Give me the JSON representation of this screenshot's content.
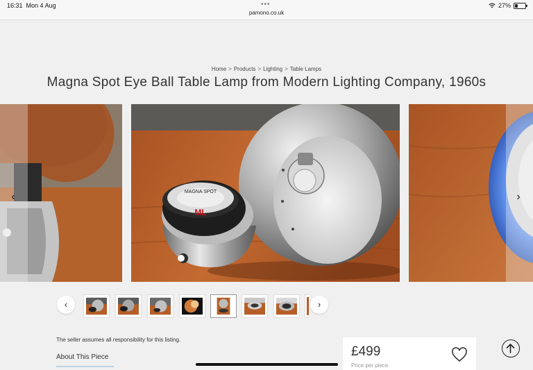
{
  "status": {
    "time": "16:31",
    "date": "Mon 4 Aug",
    "url": "pamono.co.uk",
    "battery": "27%",
    "battery_level": 0.27
  },
  "breadcrumb": [
    "Home",
    "Products",
    "Lighting",
    "Table Lamps"
  ],
  "breadcrumb_separator": ">",
  "title": "Magna Spot Eye Ball Table Lamp from Modern Lighting Company, 1960s",
  "gallery": {
    "prev_icon": "chevron-left-icon",
    "next_icon": "chevron-right-icon",
    "colors": {
      "wood": "#b8622a",
      "wall": "#5a5a5a",
      "chrome": "#c9c9c9"
    }
  },
  "product_label": {
    "brand": "MAGNA SPOT",
    "mark": "ML"
  },
  "thumbnails": {
    "count": 8,
    "selected_index": 4
  },
  "seller_note": "The seller assumes all responsibility for this listing.",
  "about_tab": "About This Piece",
  "price": {
    "value": "£499",
    "caption": "Price per piece"
  },
  "icons": {
    "favorite": "heart-icon",
    "scroll_top": "arrow-up-icon"
  },
  "colors": {
    "background": "#f0f0f0",
    "card": "#ffffff",
    "tab_underline": "#b9d3e6"
  }
}
